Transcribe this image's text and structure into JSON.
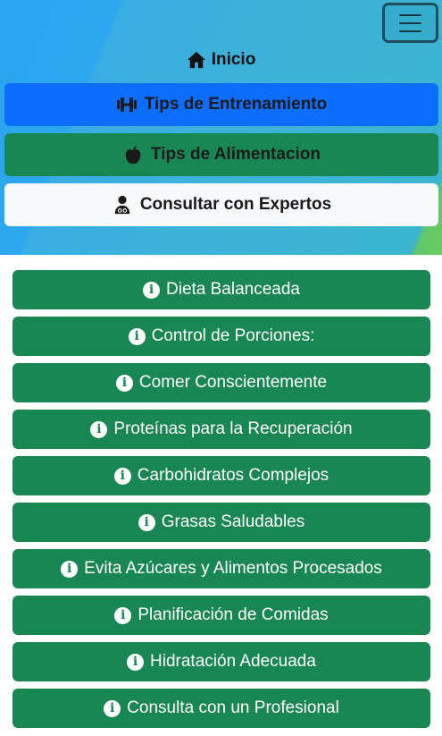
{
  "header": {
    "menu_icon": "hamburger-icon",
    "home": {
      "icon": "house-icon",
      "label": "Inicio"
    },
    "nav": [
      {
        "icon": "dumbbell-icon",
        "label": "Tips de Entrenamiento",
        "color": "#0d6efd"
      },
      {
        "icon": "apple-icon",
        "label": "Tips de Alimentacion",
        "color": "#198754"
      },
      {
        "icon": "doctor-icon",
        "label": "Consultar con Expertos",
        "color": "#f8f9fa"
      }
    ]
  },
  "tips": {
    "icon": "info-circle-icon",
    "color": "#198754",
    "items": [
      "Dieta Balanceada",
      "Control de Porciones:",
      "Comer Conscientemente",
      "Proteínas para la Recuperación",
      "Carbohidratos Complejos",
      "Grasas Saludables",
      "Evita Azúcares y Alimentos Procesados",
      "Planificación de Comidas",
      "Hidratación Adecuada",
      "Consulta con un Profesional"
    ]
  }
}
